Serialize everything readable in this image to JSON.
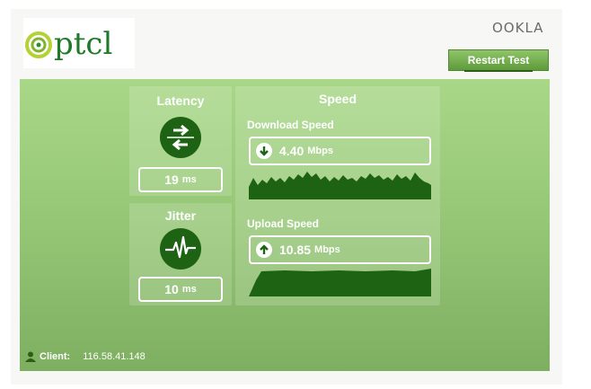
{
  "brand": {
    "logo_text": "ptcl",
    "ookla_text": "OOKLA"
  },
  "toolbar": {
    "restart_label": "Restart Test"
  },
  "latency": {
    "title": "Latency",
    "value": "19",
    "unit": "ms",
    "icon": "arrows-icon"
  },
  "jitter": {
    "title": "Jitter",
    "value": "10",
    "unit": "ms",
    "icon": "pulse-icon"
  },
  "speed": {
    "title": "Speed",
    "download": {
      "label": "Download Speed",
      "value": "4.40",
      "unit": "Mbps",
      "icon": "download-arrow-icon"
    },
    "upload": {
      "label": "Upload Speed",
      "value": "10.85",
      "unit": "Mbps",
      "icon": "upload-arrow-icon"
    }
  },
  "client": {
    "label": "Client:",
    "ip": "116.58.41.148"
  },
  "colors": {
    "panel": "#a8d887",
    "accent_dark": "#1e6314",
    "logo_green": "#1e7a28"
  }
}
